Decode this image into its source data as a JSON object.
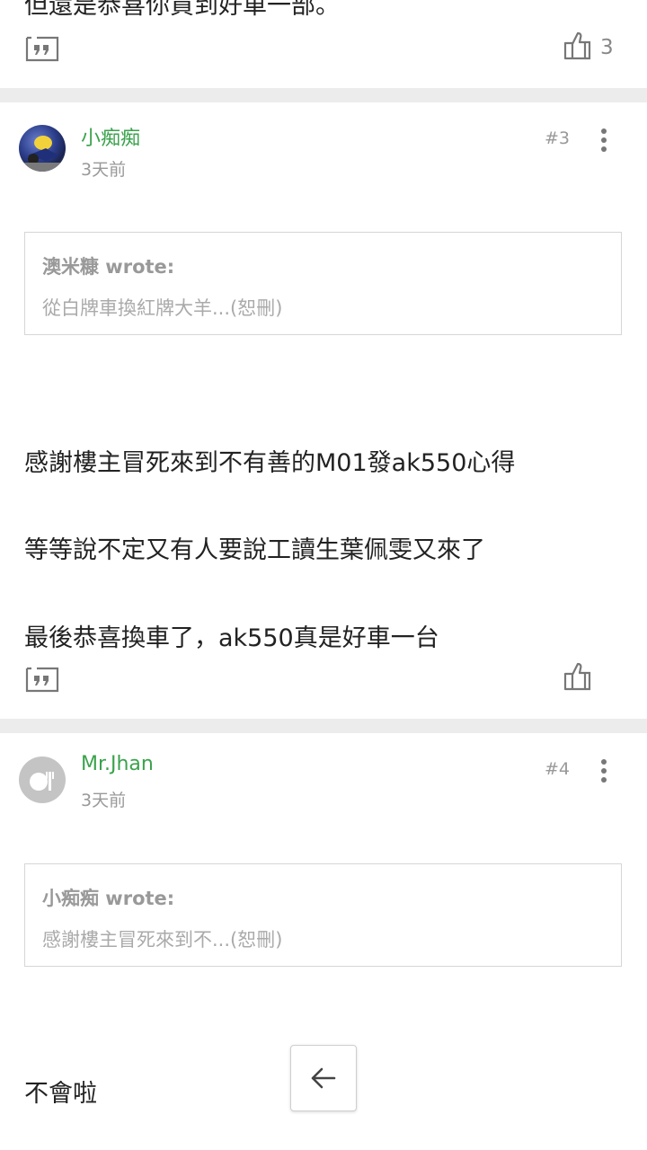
{
  "top_post": {
    "partial_text": "但還是恭喜你買到好車一部。",
    "like_count": "3"
  },
  "posts": [
    {
      "username": "小痴痴",
      "time": "3天前",
      "floor": "#3",
      "quote_author": "澳米糠 wrote:",
      "quote_text": "從白牌車換紅牌大羊...(恕刪)",
      "lines": [
        "感謝樓主冒死來到不有善的M01發ak550心得",
        "等等說不定又有人要說工讀生葉佩雯又來了",
        "最後恭喜換車了，ak550真是好車一台"
      ]
    },
    {
      "username": "Mr.Jhan",
      "time": "3天前",
      "floor": "#4",
      "quote_author": "小痴痴 wrote:",
      "quote_text": "感謝樓主冒死來到不...(恕刪)",
      "lines": [
        "不會啦"
      ]
    }
  ],
  "colors": {
    "username": "#3aa24c",
    "muted": "#999999",
    "divider": "#ececec"
  }
}
